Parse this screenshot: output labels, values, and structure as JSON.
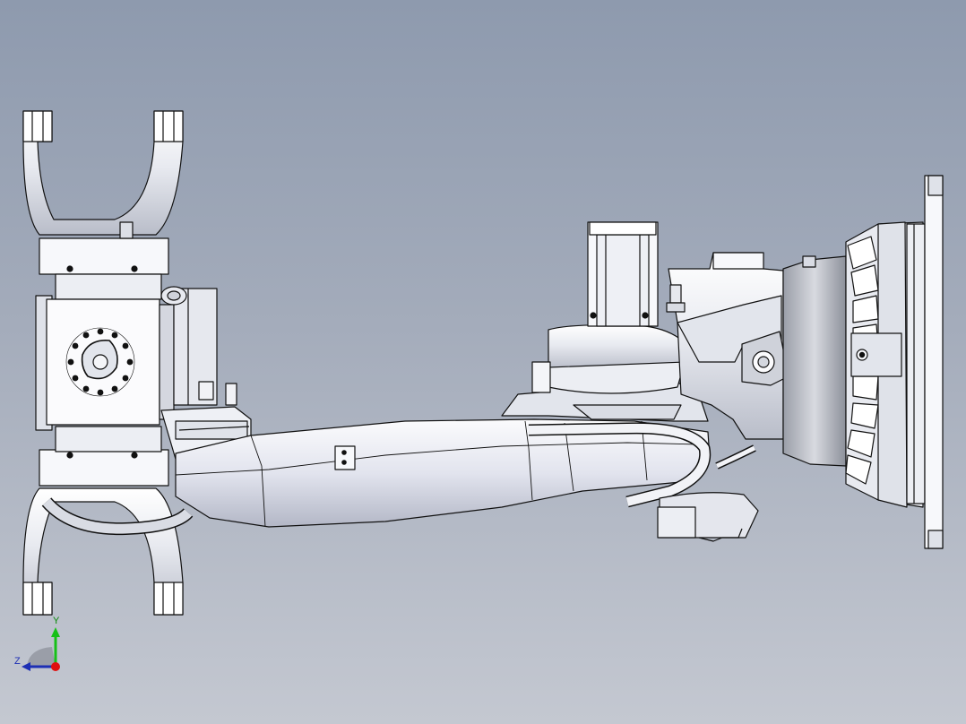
{
  "view": {
    "background_top": "#8e9aae",
    "background_bottom": "#c4c8d1",
    "model_fill": "#f4f5f8",
    "model_shade": "#c9ccd6",
    "model_dark": "#8f939e",
    "edge_color": "#101010"
  },
  "triad": {
    "y_label": "Y",
    "z_label": "Z",
    "y_color": "#16c016",
    "z_color": "#1d2fb4",
    "x_color": "#e01010"
  },
  "icons": [
    "robot-arm-model",
    "axis-triad"
  ]
}
